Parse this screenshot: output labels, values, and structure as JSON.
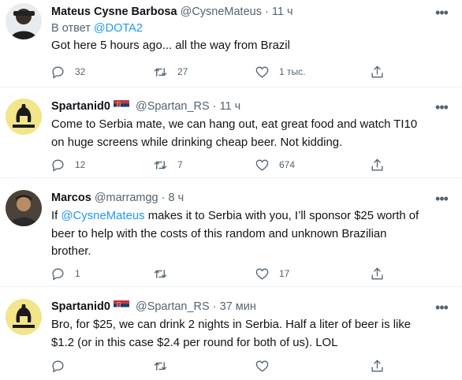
{
  "tweets": [
    {
      "name": "Mateus Cysne Barbosa",
      "handle": "@CysneMateus",
      "dot": "·",
      "time": "11 ч",
      "reply_prefix": "В ответ",
      "reply_handle": "@DOTA2",
      "text": "Got here 5 hours ago... all the way from Brazil",
      "replies": "32",
      "retweets": "27",
      "likes": "1 тыс."
    },
    {
      "name": "Spartanid0",
      "handle": "@Spartan_RS",
      "dot": "·",
      "time": "11 ч",
      "text_line1": "Come to Serbia mate, we can hang out, eat great food and watch TI10",
      "text_line2": "on huge screens while drinking cheap beer. Not kidding.",
      "replies": "12",
      "retweets": "7",
      "likes": "674"
    },
    {
      "name": "Marcos",
      "handle": "@marramgg",
      "dot": "·",
      "time": "8 ч",
      "text_prefix": "If ",
      "mention": "@CysneMateus",
      "text_line1_rest": " makes it to Serbia with you, I’ll sponsor $25 worth of",
      "text_line2": "beer to help with the costs of this random and unknown Brazilian",
      "text_line3": "brother.",
      "replies": "1",
      "retweets": "",
      "likes": "17"
    },
    {
      "name": "Spartanid0",
      "handle": "@Spartan_RS",
      "dot": "·",
      "time": "37 мин",
      "text_line1": "Bro, for $25, we can drink 2 nights in Serbia. Half a liter of beer is like",
      "text_line2": "$1.2 (or in this case $2.4 per round for both of us). LOL",
      "replies": "",
      "retweets": "",
      "likes": ""
    }
  ],
  "colors": {
    "accent": "#1d9bf0",
    "secondary_text": "#536471",
    "serbia_red": "#c6363c",
    "serbia_blue": "#0c4076"
  },
  "icons": [
    "reply-icon",
    "retweet-icon",
    "like-icon",
    "share-icon",
    "more-icon",
    "serbia-flag-icon"
  ]
}
